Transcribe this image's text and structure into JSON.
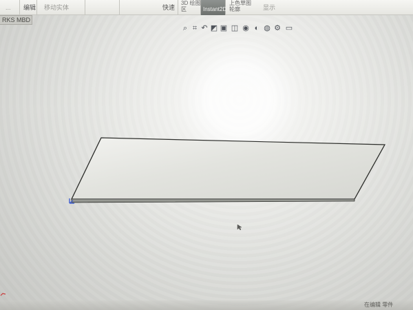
{
  "ribbon": {
    "items": [
      {
        "label": "...",
        "state": "dim"
      },
      {
        "label": "编辑",
        "state": "normal"
      },
      {
        "label": "移动实体",
        "state": "dim"
      },
      {
        "label": "快速",
        "state": "normal"
      },
      {
        "label": "显示",
        "state": "dim"
      }
    ],
    "measure": {
      "line1": "3D 绘图",
      "line2": "区"
    },
    "instant2d": {
      "sub": "",
      "label": "Instant2D"
    },
    "right_label": {
      "line1": "上色草图",
      "line2": "轮廓"
    }
  },
  "document_tab": {
    "label": "RKS MBD"
  },
  "heads_up_toolbar": {
    "icons": [
      "zoom-fit-icon",
      "zoom-area-icon",
      "previous-view-icon",
      "section-view-icon",
      "view-orientation-icon",
      "display-style-icon",
      "hide-show-icon",
      "appearance-icon",
      "scene-icon",
      "view-settings-icon",
      "monitor-icon"
    ]
  },
  "status_bar": {
    "text": "在编辑 零件"
  }
}
